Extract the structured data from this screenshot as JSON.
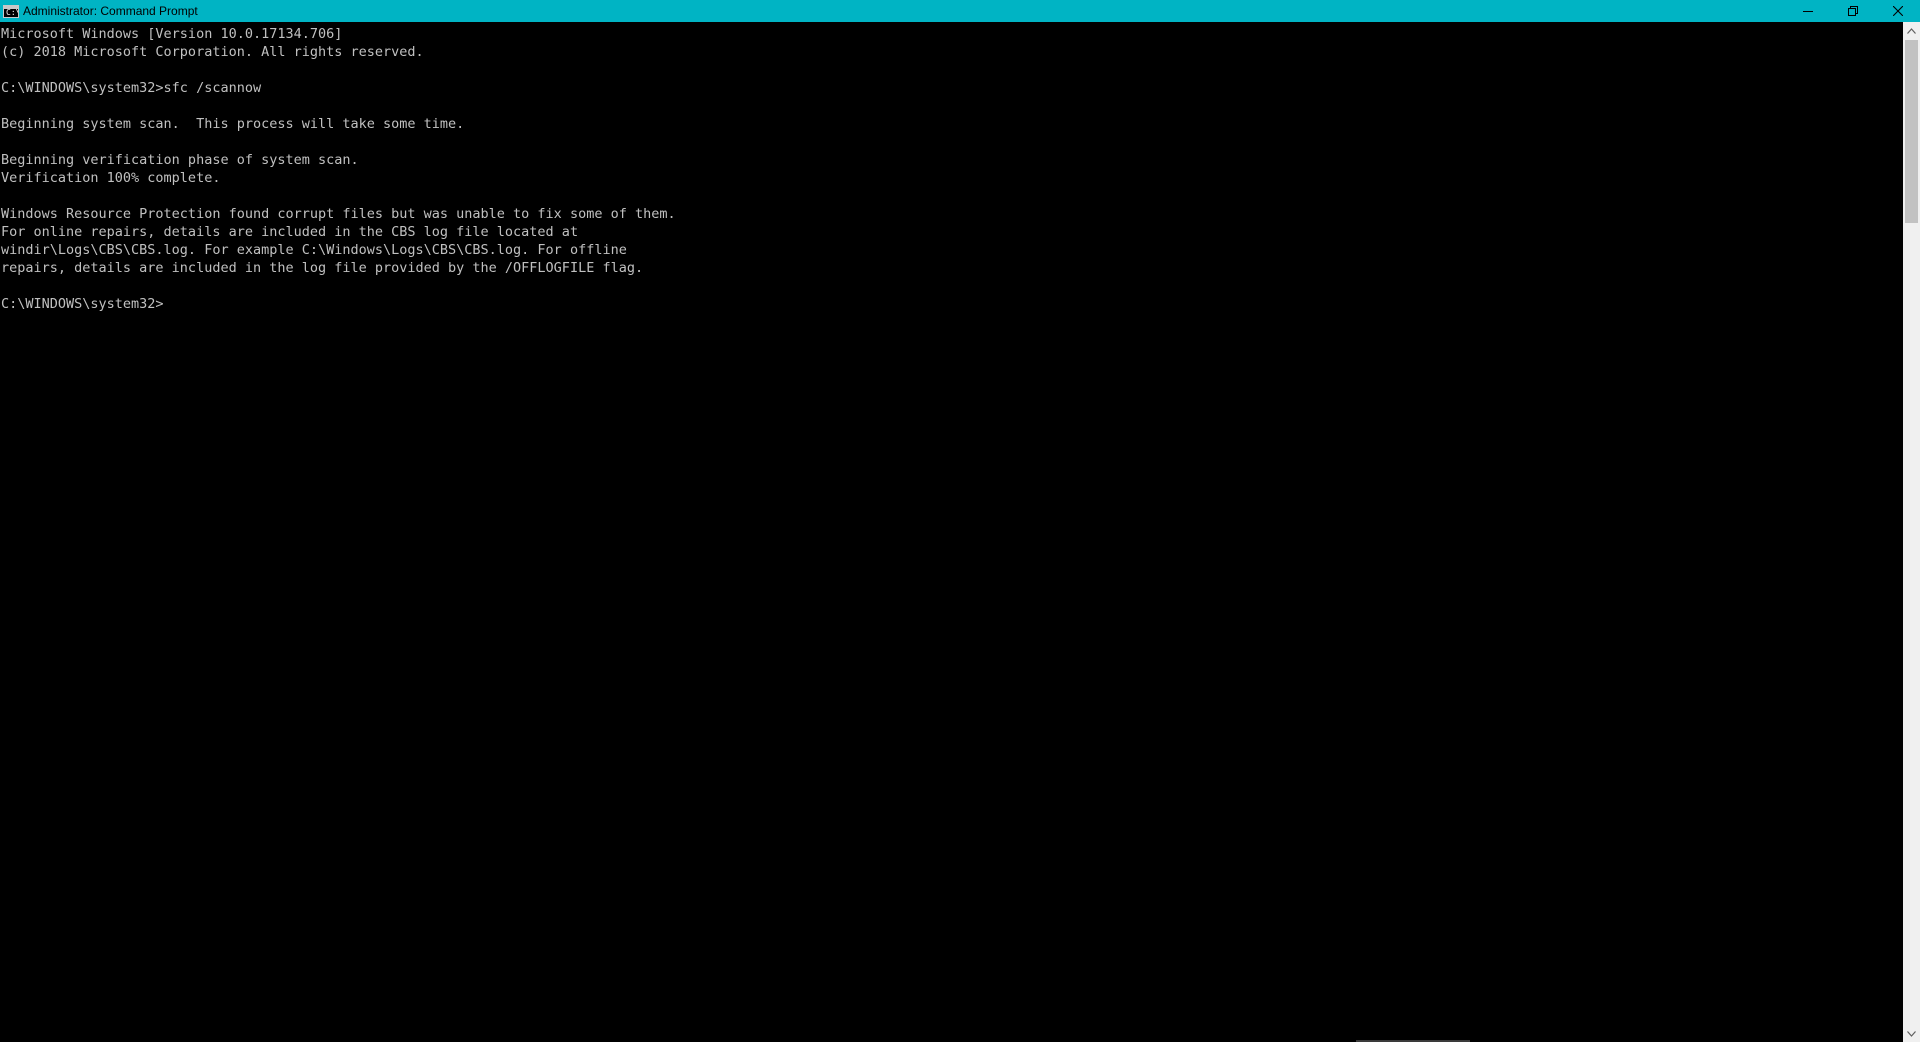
{
  "window": {
    "title": "Administrator: Command Prompt",
    "icon": "cmd-icon",
    "icon_glyph": "C:\\",
    "titlebar_color": "#00b4c4",
    "controls": {
      "minimize": "minimize-icon",
      "restore": "restore-icon",
      "close": "close-icon"
    }
  },
  "console": {
    "background": "#000000",
    "foreground": "#c0c0c0",
    "lines": [
      "Microsoft Windows [Version 10.0.17134.706]",
      "(c) 2018 Microsoft Corporation. All rights reserved.",
      "",
      "C:\\WINDOWS\\system32>sfc /scannow",
      "",
      "Beginning system scan.  This process will take some time.",
      "",
      "Beginning verification phase of system scan.",
      "Verification 100% complete.",
      "",
      "Windows Resource Protection found corrupt files but was unable to fix some of them.",
      "For online repairs, details are included in the CBS log file located at",
      "windir\\Logs\\CBS\\CBS.log. For example C:\\Windows\\Logs\\CBS\\CBS.log. For offline",
      "repairs, details are included in the log file provided by the /OFFLOGFILE flag.",
      "",
      "C:\\WINDOWS\\system32>"
    ]
  },
  "scrollbar": {
    "up_icon": "scroll-up-arrow-icon",
    "down_icon": "scroll-down-arrow-icon"
  }
}
